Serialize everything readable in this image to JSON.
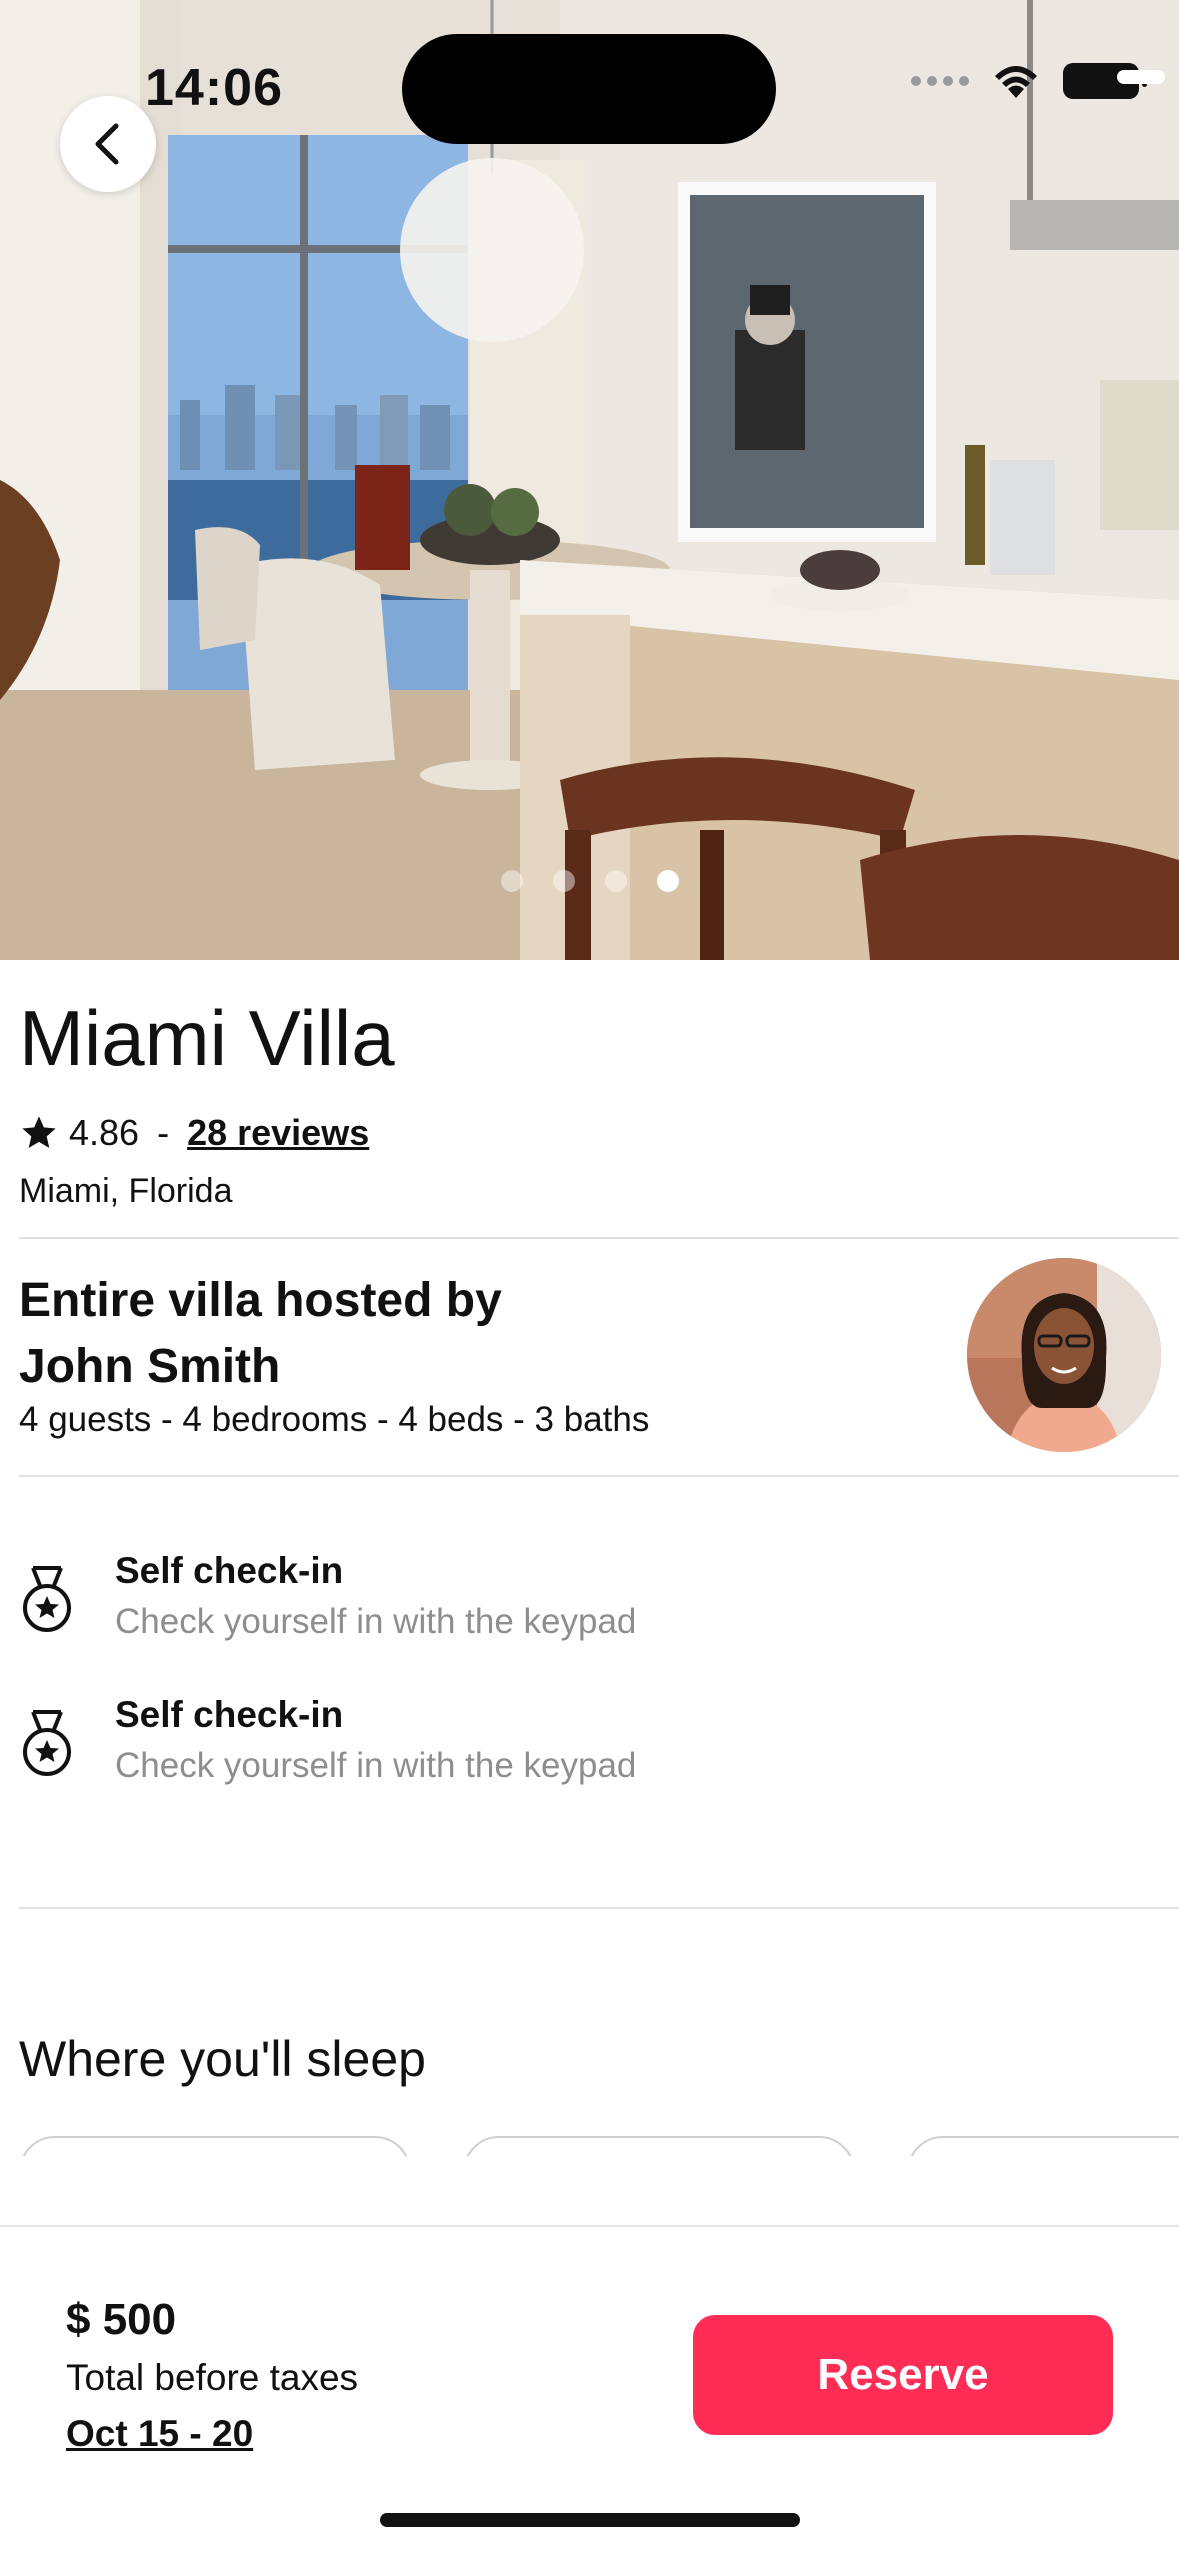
{
  "status_bar": {
    "time": "14:06"
  },
  "gallery": {
    "photo_count": 4,
    "active_index": 3
  },
  "listing": {
    "title": "Miami Villa",
    "rating": "4.86",
    "separator": "-",
    "reviews_label": "28 reviews",
    "location": "Miami, Florida"
  },
  "host": {
    "title": "Entire villa hosted by John Smith",
    "summary": "4 guests - 4 bedrooms - 4 beds - 3 baths"
  },
  "features": [
    {
      "title": "Self check-in",
      "subtitle": "Check yourself in with the keypad",
      "icon": "medal-icon"
    },
    {
      "title": "Self check-in",
      "subtitle": "Check yourself in with the keypad",
      "icon": "medal-icon"
    }
  ],
  "sleep": {
    "title": "Where you'll sleep"
  },
  "booking": {
    "price": "$ 500",
    "price_note": "Total before taxes",
    "dates": "Oct 15 - 20",
    "reserve_label": "Reserve"
  },
  "colors": {
    "accent": "#ff2d55",
    "muted_text": "#8e8e8e",
    "divider": "#e0e0e0"
  }
}
